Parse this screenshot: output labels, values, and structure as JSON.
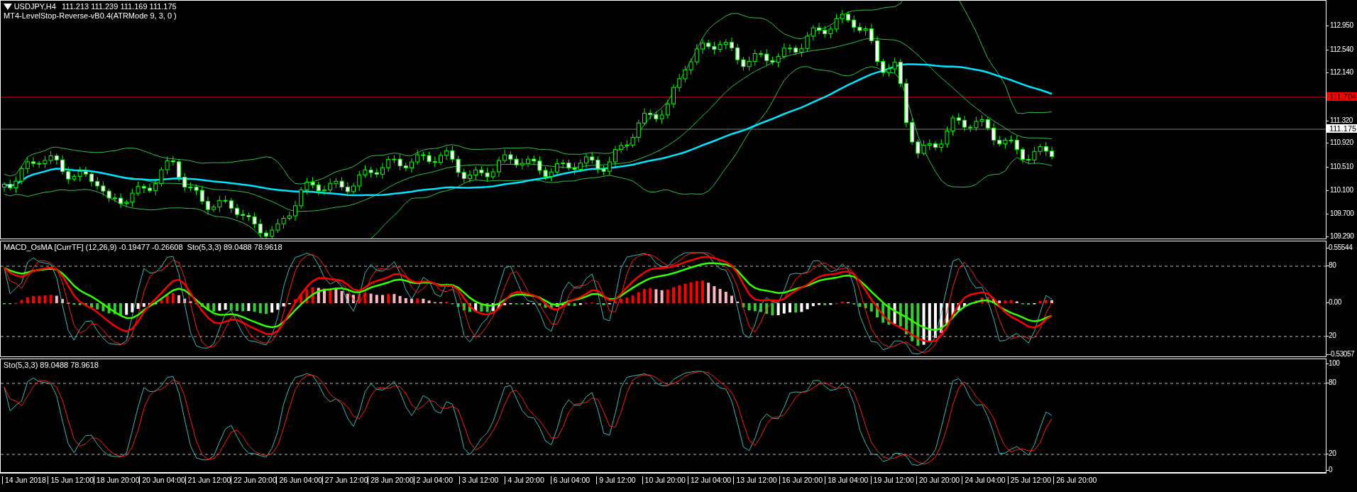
{
  "main_panel": {
    "symbol": "USDJPY,H4",
    "quotes": "111.213 111.239 111.169 111.175",
    "indicator": "MT4-LevelStop-Reverse-vB0.4(ATRMode 9, 3, 0 )",
    "price_axis": {
      "ticks": [
        "112.950",
        "112.540",
        "112.140",
        "111.320",
        "110.920",
        "110.510",
        "110.100",
        "109.700",
        "109.290"
      ],
      "markers": [
        {
          "text": "111.704",
          "color": "#ff0000"
        },
        {
          "text": "111.175",
          "color": "#ffffff"
        }
      ]
    }
  },
  "macd_panel": {
    "label": "MACD_OsMA [CurrTF] (12,26,9) -0.19477 -0.26608  Sto(5,3,3) 89.0488 78.9618",
    "axis": [
      "0.55544",
      "80",
      "0.00",
      "20",
      "-0.53057"
    ]
  },
  "stochastic_panel": {
    "label": "Sto(5,3,3) 89.0488 78.9618",
    "axis": [
      "100",
      "80",
      "20",
      "0"
    ]
  },
  "time_axis": [
    "14 Jun 2018",
    "15 Jun 12:00",
    "18 Jun 20:00",
    "20 Jun 04:00",
    "21 Jun 12:00",
    "22 Jun 20:00",
    "26 Jun 04:00",
    "27 Jun 12:00",
    "28 Jun 20:00",
    "2 Jul 04:00",
    "3 Jul 12:00",
    "4 Jul 20:00",
    "6 Jul 04:00",
    "9 Jul 12:00",
    "10 Jul 20:00",
    "12 Jul 04:00",
    "13 Jul 12:00",
    "16 Jul 20:00",
    "18 Jul 04:00",
    "19 Jul 12:00",
    "20 Jul 20:00",
    "24 Jul 04:00",
    "25 Jul 12:00",
    "26 Jul 20:00"
  ]
}
